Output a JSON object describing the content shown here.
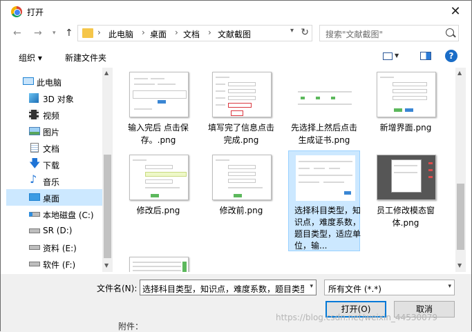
{
  "window": {
    "title": "打开"
  },
  "address": {
    "crumbs": [
      "此电脑",
      "桌面",
      "文档",
      "文献截图"
    ]
  },
  "search": {
    "placeholder": "搜索\"文献截图\""
  },
  "toolbar": {
    "organize": "组织 ▾",
    "new_folder": "新建文件夹"
  },
  "sidebar": {
    "items": [
      {
        "label": "此电脑",
        "icon": "computer-icon"
      },
      {
        "label": "3D 对象",
        "icon": "cube-icon"
      },
      {
        "label": "视频",
        "icon": "film-icon"
      },
      {
        "label": "图片",
        "icon": "picture-icon"
      },
      {
        "label": "文档",
        "icon": "document-icon"
      },
      {
        "label": "下载",
        "icon": "download-icon"
      },
      {
        "label": "音乐",
        "icon": "music-icon"
      },
      {
        "label": "桌面",
        "icon": "desktop-icon",
        "selected": true
      },
      {
        "label": "本地磁盘 (C:)",
        "icon": "drive-icon"
      },
      {
        "label": "SR (D:)",
        "icon": "drive-icon"
      },
      {
        "label": "资料 (E:)",
        "icon": "drive-icon"
      },
      {
        "label": "软件 (F:)",
        "icon": "drive-icon"
      }
    ]
  },
  "files": [
    {
      "name": "输入完后 点击保存。.png"
    },
    {
      "name": "填写完了信息点击完成.png"
    },
    {
      "name": "先选择上然后点击生成证书.png"
    },
    {
      "name": "新增界面.png"
    },
    {
      "name": "修改后.png"
    },
    {
      "name": "修改前.png"
    },
    {
      "name": "选择科目类型，知识点，难度系数，题目类型，适应单位，输...",
      "selected": true
    },
    {
      "name": "员工修改模态窗体.png"
    },
    {
      "name": ""
    }
  ],
  "bottom": {
    "filename_label": "文件名(N):",
    "filename_value": "选择科目类型，知识点，难度系数，题目类型",
    "filetype_value": "所有文件 (*.*)",
    "open_label": "打开(O)",
    "cancel_label": "取消"
  },
  "background": {
    "under_text": "附件：",
    "watermark": "https://blog.csdn.net/weixin_44530079"
  }
}
